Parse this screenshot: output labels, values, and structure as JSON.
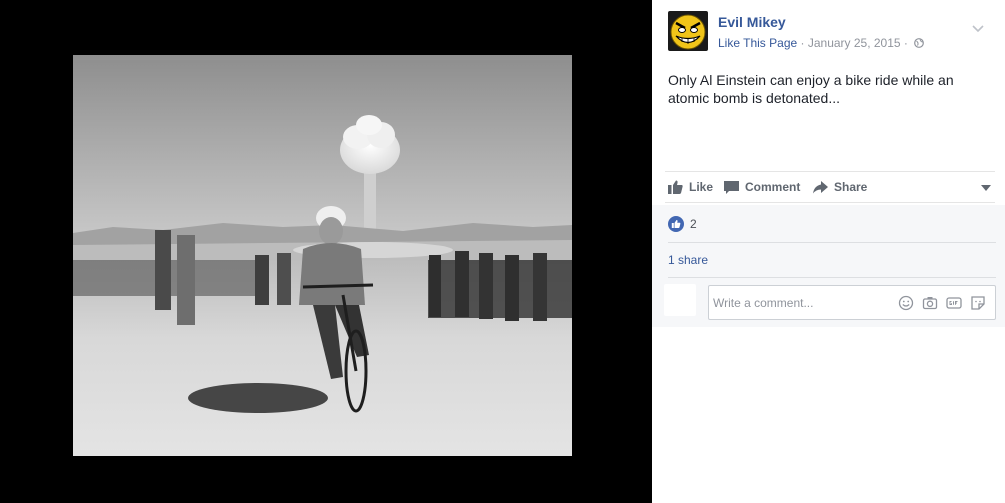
{
  "post": {
    "page_name": "Evil Mikey",
    "like_link": "Like This Page",
    "separator": " · ",
    "date": "January 25, 2015",
    "separator2": " · ",
    "text": "Only Al Einstein can enjoy a bike ride while an atomic bomb is detonated..."
  },
  "actions": {
    "like": "Like",
    "comment": "Comment",
    "share": "Share"
  },
  "feedback": {
    "reaction_count": "2",
    "shares": "1 share",
    "comment_placeholder": "Write a comment..."
  },
  "icons": {
    "avatar": "evil-smiley-avatar",
    "audience": "globe-icon",
    "menu": "chevron-down-icon",
    "like": "thumbs-up-icon",
    "comment": "speech-bubble-icon",
    "share": "share-arrow-icon",
    "reaction": "like-reaction-icon",
    "emoji": "emoji-icon",
    "camera": "camera-icon",
    "gif": "gif-icon",
    "sticker": "sticker-icon"
  },
  "colors": {
    "link": "#365899",
    "muted": "#90949c",
    "text": "#1d2129",
    "like_blue": "#4267b2",
    "viewer_bg": "#000000"
  }
}
